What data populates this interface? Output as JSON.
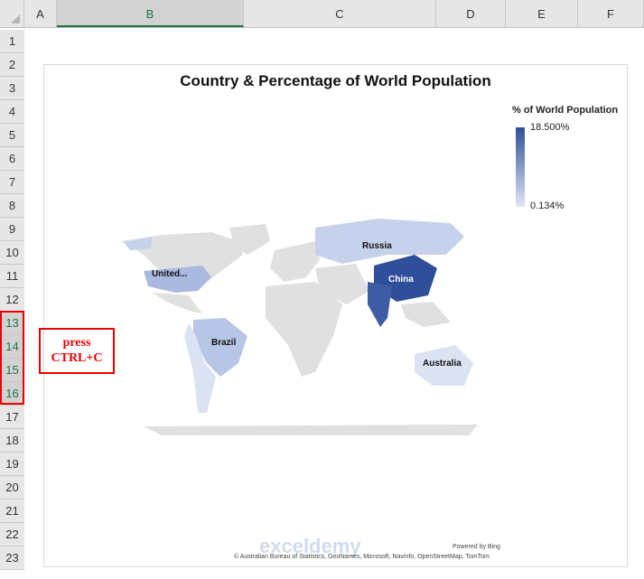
{
  "columns": [
    "A",
    "B",
    "C",
    "D",
    "E",
    "F"
  ],
  "rows": [
    "1",
    "2",
    "3",
    "4",
    "5",
    "6",
    "7",
    "8",
    "9",
    "10",
    "11",
    "12",
    "13",
    "14",
    "15",
    "16",
    "17",
    "18",
    "19",
    "20",
    "21",
    "22",
    "23"
  ],
  "chart": {
    "title": "Country & Percentage of World Population",
    "legend_title": "% of World Population",
    "legend_max": "18.500%",
    "legend_min": "0.134%",
    "labels": {
      "us": "United...",
      "russia": "Russia",
      "china": "China",
      "brazil": "Brazil",
      "australia": "Australia"
    },
    "powered": "Powered by Bing",
    "credits": "© Australian Bureau of Statistics, GeoNames, Microsoft, Navinfo, OpenStreetMap, TomTom",
    "watermark": "exceldemy",
    "colors": {
      "max": "#2f4f9a",
      "min": "#dfe6f5",
      "land": "#e0e0e0"
    }
  },
  "note": {
    "line1": "press",
    "line2": "CTRL+C"
  }
}
